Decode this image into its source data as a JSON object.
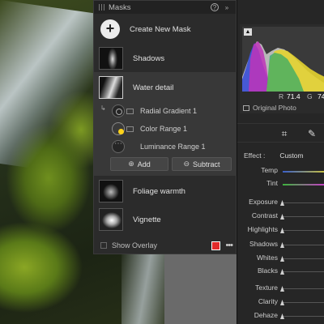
{
  "masks_panel": {
    "title": "Masks",
    "help_glyph": "?",
    "collapse_glyph": "»",
    "create_label": "Create New Mask",
    "create_glyph": "+",
    "masks": [
      {
        "name": "Shadows",
        "icon": "shadows-mask-thumbnail"
      },
      {
        "name": "Water detail",
        "icon": "water-detail-mask-thumbnail",
        "selected": true
      },
      {
        "name": "Foliage warmth",
        "icon": "foliage-mask-thumbnail"
      },
      {
        "name": "Vignette",
        "icon": "vignette-mask-thumbnail"
      }
    ],
    "components": [
      {
        "name": "Radial Gradient 1",
        "icon": "radial-gradient-icon"
      },
      {
        "name": "Color Range 1",
        "icon": "color-range-icon"
      },
      {
        "name": "Luminance Range 1",
        "icon": "luminance-range-icon"
      }
    ],
    "add_label": "Add",
    "subtract_label": "Subtract",
    "show_overlay_label": "Show Overlay",
    "overlay_color": "#e02a2a",
    "more_glyph": "•••"
  },
  "histogram": {
    "clip_glyph": "▲",
    "r_label": "R",
    "r_value": "71.4",
    "g_label": "G",
    "g_value": "74",
    "original_photo_label": "Original Photo"
  },
  "edit": {
    "effect_label": "Effect :",
    "effect_value": "Custom",
    "sliders": [
      "Temp",
      "Tint",
      "Exposure",
      "Contrast",
      "Highlights",
      "Shadows",
      "Whites",
      "Blacks",
      "Texture",
      "Clarity",
      "Dehaze"
    ]
  },
  "colors": {
    "panel_bg": "#2b2b2b",
    "selected_bg": "#383838",
    "accent_yellow": "#ffd21a"
  }
}
